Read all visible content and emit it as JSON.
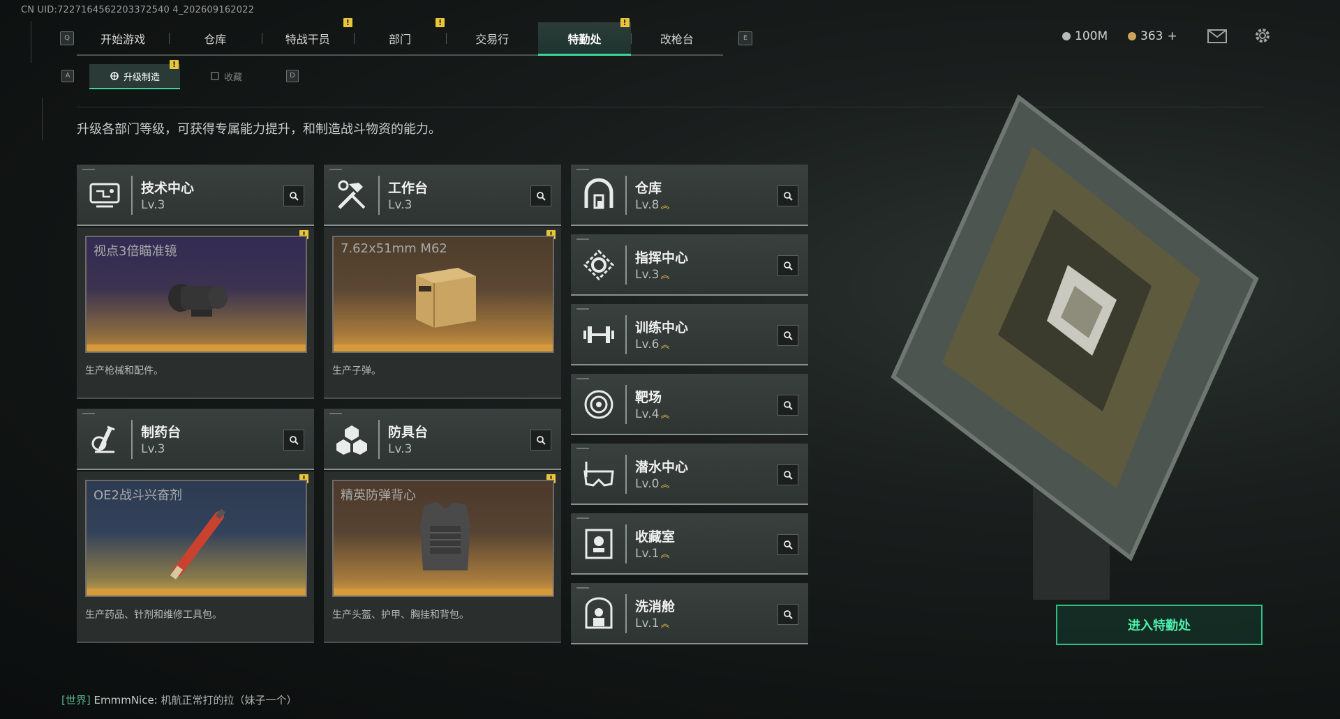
{
  "uid": "CN UID:7227164562203372540 4_202609162022",
  "nav": {
    "key_left": "Q",
    "key_right": "E",
    "items": [
      {
        "label": "开始游戏",
        "alert": false
      },
      {
        "label": "仓库",
        "alert": false
      },
      {
        "label": "特战干员",
        "alert": true
      },
      {
        "label": "部门",
        "alert": true
      },
      {
        "label": "交易行",
        "alert": false
      },
      {
        "label": "特勤处",
        "alert": true,
        "active": true
      },
      {
        "label": "改枪台",
        "alert": false
      }
    ]
  },
  "subtabs": {
    "key_left": "A",
    "key_right": "D",
    "active_label": "升级制造",
    "inactive_label": "收藏"
  },
  "currency": {
    "silver": "100M",
    "gold": "363",
    "add": "+"
  },
  "description": "升级各部门等级，可获得专属能力提升，和制造战斗物资的能力。",
  "alert_mark": "!",
  "left_cards": [
    {
      "name": "技术中心",
      "level": "Lv.3",
      "item_name": "视点3倍瞄准镜",
      "desc": "生产枪械和配件。",
      "icon": "tech-center-icon",
      "theme": "#3a3358"
    },
    {
      "name": "工作台",
      "level": "Lv.3",
      "item_name": "7.62x51mm M62",
      "desc": "生产子弹。",
      "icon": "workbench-icon",
      "theme": "#54412b"
    },
    {
      "name": "制药台",
      "level": "Lv.3",
      "item_name": "OE2战斗兴奋剂",
      "desc": "生产药品、针剂和维修工具包。",
      "icon": "pharmacy-icon",
      "theme": "#2f3b4f"
    },
    {
      "name": "防具台",
      "level": "Lv.3",
      "item_name": "精英防弹背心",
      "desc": "生产头盔、护甲、胸挂和背包。",
      "icon": "armor-bench-icon",
      "theme": "#4d3a2b"
    }
  ],
  "right_cards": [
    {
      "name": "仓库",
      "level": "Lv.8",
      "icon": "warehouse-icon"
    },
    {
      "name": "指挥中心",
      "level": "Lv.3",
      "icon": "command-center-icon"
    },
    {
      "name": "训练中心",
      "level": "Lv.6",
      "icon": "training-center-icon"
    },
    {
      "name": "靶场",
      "level": "Lv.4",
      "icon": "shooting-range-icon"
    },
    {
      "name": "潜水中心",
      "level": "Lv.0",
      "icon": "diving-center-icon"
    },
    {
      "name": "收藏室",
      "level": "Lv.1",
      "icon": "collection-room-icon"
    },
    {
      "name": "洗消舱",
      "level": "Lv.1",
      "icon": "decontamination-icon"
    }
  ],
  "enter_button": "进入特勤处",
  "chat": {
    "channel": "[世界]",
    "user": "EmmmNice:",
    "message": "机航正常打的拉（妹子一个）"
  },
  "colors": {
    "accent": "#3fd39a",
    "alert": "#e8c53a",
    "upgrade": "#e6b84a"
  }
}
